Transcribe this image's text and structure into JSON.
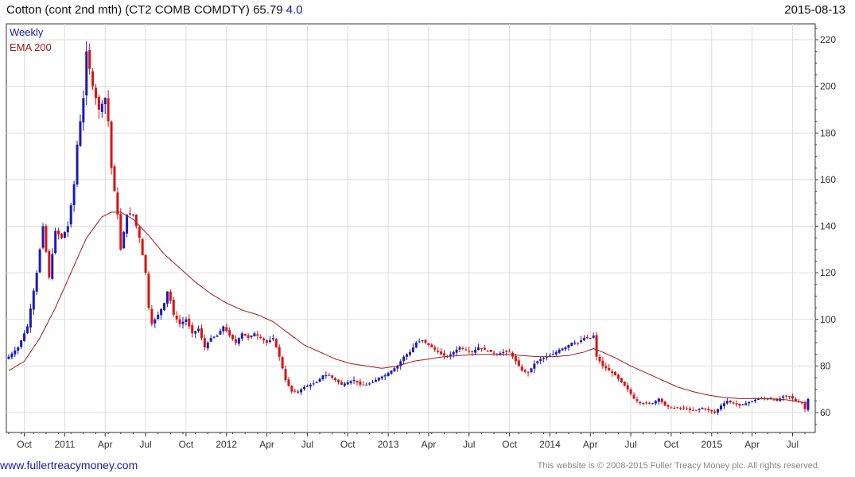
{
  "header": {
    "title": "Cotton (cont 2nd mth) (CT2 COMB COMDTY) 65.79",
    "change": "4.0",
    "date": "2015-08-13"
  },
  "legend": {
    "series_label": "Weekly",
    "ema_label": "EMA 200"
  },
  "footer": {
    "site": "www.fullertreacymoney.com",
    "copyright": "This website is © 2008-2015 Fuller Treacy Money plc. All rights reserved."
  },
  "colors": {
    "up": "#1a1ab8",
    "down": "#dd1111",
    "ema": "#a01a1a",
    "grid": "#dddddd",
    "axis": "#333333",
    "legend_weekly": "#1a1aa8",
    "legend_ema": "#a01a1a"
  },
  "chart_data": {
    "type": "candlestick",
    "period": "weekly",
    "ylim": [
      50,
      225
    ],
    "y_ticks": [
      60,
      80,
      100,
      120,
      140,
      160,
      180,
      200,
      220
    ],
    "x_ticks": [
      {
        "label": "Oct",
        "week": 5
      },
      {
        "label": "2011",
        "week": 18
      },
      {
        "label": "Apr",
        "week": 31
      },
      {
        "label": "Jul",
        "week": 44
      },
      {
        "label": "Oct",
        "week": 57
      },
      {
        "label": "2012",
        "week": 70
      },
      {
        "label": "Apr",
        "week": 83
      },
      {
        "label": "Jul",
        "week": 96
      },
      {
        "label": "Oct",
        "week": 109
      },
      {
        "label": "2013",
        "week": 122
      },
      {
        "label": "Apr",
        "week": 135
      },
      {
        "label": "Jul",
        "week": 148
      },
      {
        "label": "Oct",
        "week": 161
      },
      {
        "label": "2014",
        "week": 174
      },
      {
        "label": "Apr",
        "week": 187
      },
      {
        "label": "Jul",
        "week": 200
      },
      {
        "label": "Oct",
        "week": 213
      },
      {
        "label": "2015",
        "week": 226
      },
      {
        "label": "Apr",
        "week": 239
      },
      {
        "label": "Jul",
        "week": 252
      }
    ],
    "close_anchors": [
      [
        0,
        84
      ],
      [
        3,
        88
      ],
      [
        6,
        97
      ],
      [
        9,
        120
      ],
      [
        11,
        140
      ],
      [
        13,
        118
      ],
      [
        15,
        138
      ],
      [
        17,
        135
      ],
      [
        19,
        140
      ],
      [
        21,
        158
      ],
      [
        22,
        175
      ],
      [
        24,
        195
      ],
      [
        25,
        215
      ],
      [
        27,
        200
      ],
      [
        29,
        190
      ],
      [
        31,
        195
      ],
      [
        32,
        185
      ],
      [
        33,
        165
      ],
      [
        35,
        145
      ],
      [
        36,
        130
      ],
      [
        38,
        145
      ],
      [
        40,
        145
      ],
      [
        42,
        135
      ],
      [
        44,
        120
      ],
      [
        45,
        105
      ],
      [
        46,
        98
      ],
      [
        48,
        102
      ],
      [
        50,
        107
      ],
      [
        51,
        112
      ],
      [
        52,
        108
      ],
      [
        53,
        102
      ],
      [
        55,
        98
      ],
      [
        57,
        100
      ],
      [
        59,
        94
      ],
      [
        61,
        96
      ],
      [
        63,
        88
      ],
      [
        65,
        92
      ],
      [
        67,
        93
      ],
      [
        69,
        97
      ],
      [
        71,
        93
      ],
      [
        73,
        90
      ],
      [
        75,
        94
      ],
      [
        77,
        92
      ],
      [
        79,
        94
      ],
      [
        81,
        92
      ],
      [
        83,
        90
      ],
      [
        85,
        92
      ],
      [
        87,
        84
      ],
      [
        89,
        74
      ],
      [
        91,
        69
      ],
      [
        93,
        69
      ],
      [
        95,
        71
      ],
      [
        97,
        72
      ],
      [
        99,
        73
      ],
      [
        101,
        76
      ],
      [
        103,
        76
      ],
      [
        105,
        74
      ],
      [
        107,
        72
      ],
      [
        109,
        73
      ],
      [
        111,
        74
      ],
      [
        113,
        72
      ],
      [
        115,
        72
      ],
      [
        117,
        73
      ],
      [
        119,
        75
      ],
      [
        121,
        76
      ],
      [
        123,
        78
      ],
      [
        125,
        80
      ],
      [
        127,
        84
      ],
      [
        129,
        86
      ],
      [
        131,
        90
      ],
      [
        133,
        91
      ],
      [
        135,
        89
      ],
      [
        137,
        87
      ],
      [
        139,
        85
      ],
      [
        141,
        84
      ],
      [
        143,
        86
      ],
      [
        145,
        88
      ],
      [
        147,
        87
      ],
      [
        149,
        86
      ],
      [
        151,
        88
      ],
      [
        153,
        87
      ],
      [
        155,
        86
      ],
      [
        157,
        85
      ],
      [
        159,
        86
      ],
      [
        161,
        86
      ],
      [
        163,
        82
      ],
      [
        165,
        78
      ],
      [
        167,
        77
      ],
      [
        169,
        81
      ],
      [
        171,
        83
      ],
      [
        173,
        84
      ],
      [
        175,
        85
      ],
      [
        177,
        87
      ],
      [
        179,
        88
      ],
      [
        181,
        90
      ],
      [
        183,
        90
      ],
      [
        185,
        92
      ],
      [
        187,
        92
      ],
      [
        188,
        93
      ],
      [
        189,
        84
      ],
      [
        191,
        80
      ],
      [
        193,
        78
      ],
      [
        195,
        76
      ],
      [
        197,
        73
      ],
      [
        199,
        70
      ],
      [
        201,
        66
      ],
      [
        203,
        64
      ],
      [
        205,
        64
      ],
      [
        207,
        64
      ],
      [
        209,
        66
      ],
      [
        211,
        63
      ],
      [
        213,
        62
      ],
      [
        215,
        62
      ],
      [
        217,
        62
      ],
      [
        219,
        61
      ],
      [
        221,
        61
      ],
      [
        223,
        62
      ],
      [
        225,
        61
      ],
      [
        227,
        60
      ],
      [
        229,
        63
      ],
      [
        231,
        65
      ],
      [
        233,
        64
      ],
      [
        235,
        63
      ],
      [
        237,
        64
      ],
      [
        239,
        65
      ],
      [
        241,
        66
      ],
      [
        243,
        66
      ],
      [
        245,
        66
      ],
      [
        247,
        65
      ],
      [
        249,
        67
      ],
      [
        251,
        67
      ],
      [
        253,
        65
      ],
      [
        255,
        64
      ],
      [
        256,
        61.5
      ],
      [
        257,
        65.8
      ]
    ],
    "ema_anchors": [
      [
        0,
        78
      ],
      [
        5,
        82
      ],
      [
        10,
        92
      ],
      [
        15,
        105
      ],
      [
        20,
        120
      ],
      [
        25,
        135
      ],
      [
        30,
        144
      ],
      [
        33,
        146
      ],
      [
        36,
        146
      ],
      [
        40,
        143
      ],
      [
        45,
        136
      ],
      [
        50,
        128
      ],
      [
        55,
        122
      ],
      [
        60,
        116
      ],
      [
        65,
        111
      ],
      [
        70,
        107
      ],
      [
        75,
        104
      ],
      [
        80,
        102
      ],
      [
        85,
        99
      ],
      [
        90,
        94
      ],
      [
        95,
        89
      ],
      [
        100,
        86
      ],
      [
        105,
        83
      ],
      [
        110,
        81
      ],
      [
        115,
        80
      ],
      [
        120,
        79
      ],
      [
        125,
        80
      ],
      [
        130,
        82
      ],
      [
        135,
        83
      ],
      [
        140,
        84
      ],
      [
        145,
        84.5
      ],
      [
        150,
        85
      ],
      [
        155,
        85
      ],
      [
        160,
        85
      ],
      [
        165,
        84.5
      ],
      [
        170,
        84
      ],
      [
        175,
        84
      ],
      [
        180,
        84.5
      ],
      [
        185,
        86
      ],
      [
        188,
        87.5
      ],
      [
        190,
        86.5
      ],
      [
        195,
        83.5
      ],
      [
        200,
        80
      ],
      [
        205,
        77
      ],
      [
        210,
        74
      ],
      [
        215,
        71
      ],
      [
        220,
        69
      ],
      [
        225,
        67.5
      ],
      [
        230,
        66.5
      ],
      [
        235,
        66
      ],
      [
        240,
        66
      ],
      [
        245,
        66
      ],
      [
        250,
        65.5
      ],
      [
        255,
        64.5
      ],
      [
        257,
        64
      ]
    ]
  }
}
